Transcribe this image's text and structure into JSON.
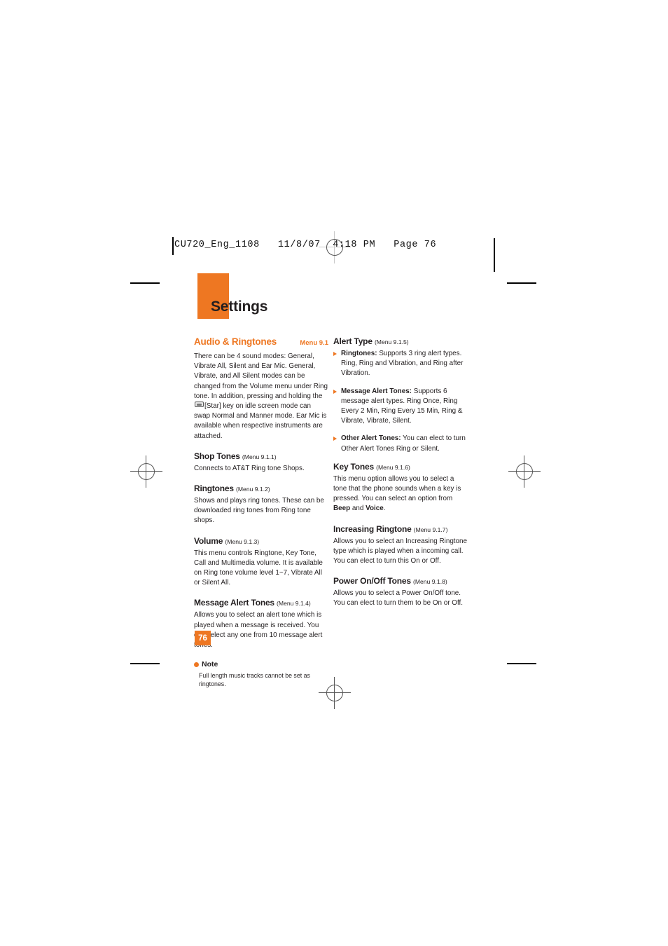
{
  "proof_header": "CU720_Eng_1108   11/8/07  4:18 PM   Page 76",
  "page_title": "Settings",
  "page_number": "76",
  "colors": {
    "accent_orange": "#ee7722",
    "body_text": "#231f20"
  },
  "left_column": {
    "section": {
      "title": "Audio & Ringtones",
      "menu": "Menu 9.1"
    },
    "intro_part1": "There can be 4 sound modes: General, Vibrate All, Silent and Ear Mic. General, Vibrate, and All Silent modes can be changed from the Volume menu under Ring tone. In addition, pressing and holding the",
    "intro_part2": "[Star] key on idle screen mode can swap Normal and Manner mode. Ear Mic is available when respective instruments are attached.",
    "key_icon": "star-key-icon",
    "subsections": [
      {
        "title": "Shop Tones",
        "menu": "(Menu 9.1.1)",
        "body": "Connects to AT&T Ring tone Shops."
      },
      {
        "title": "Ringtones",
        "menu": "(Menu 9.1.2)",
        "body": "Shows and plays ring tones. These can be downloaded ring tones from Ring tone shops."
      },
      {
        "title": "Volume",
        "menu": "(Menu 9.1.3)",
        "body": "This menu controls Ringtone, Key Tone, Call and Multimedia volume. It is available on Ring tone volume level 1~7, Vibrate All or Silent All."
      },
      {
        "title": "Message Alert Tones",
        "menu": "(Menu 9.1.4)",
        "body": "Allows you to select an alert tone which is played when a message is received. You can select any one from 10 message alert tones."
      }
    ],
    "note": {
      "label": "Note",
      "text": "Full length music tracks cannot be set as ringtones."
    }
  },
  "right_column": {
    "alert_type": {
      "title": "Alert Type",
      "menu": "(Menu 9.1.5)",
      "bullets": [
        {
          "label": "Ringtones:",
          "text": " Supports 3 ring alert types. Ring, Ring and Vibration, and Ring after Vibration."
        },
        {
          "label": "Message Alert Tones:",
          "text": " Supports 6 message alert types. Ring Once, Ring Every 2 Min, Ring Every 15 Min, Ring & Vibrate, Vibrate, Silent."
        },
        {
          "label": "Other Alert Tones:",
          "text": " You can elect to turn Other Alert Tones Ring or Silent."
        }
      ]
    },
    "key_tones": {
      "title": "Key Tones",
      "menu": "(Menu 9.1.6)",
      "body_part1": "This menu option allows you to select a tone that the phone sounds when a key is pressed. You can select an option from ",
      "bold1": "Beep",
      "body_part2": " and ",
      "bold2": "Voice",
      "body_part3": "."
    },
    "subsections": [
      {
        "title": "Increasing Ringtone",
        "menu": "(Menu 9.1.7)",
        "body": "Allows you to select an Increasing Ringtone type which is played when a incoming call. You can elect to turn this On or Off."
      },
      {
        "title": "Power On/Off Tones",
        "menu": "(Menu 9.1.8)",
        "body": "Allows you to select a Power On/Off tone. You can elect to turn them to be On or Off."
      }
    ]
  }
}
